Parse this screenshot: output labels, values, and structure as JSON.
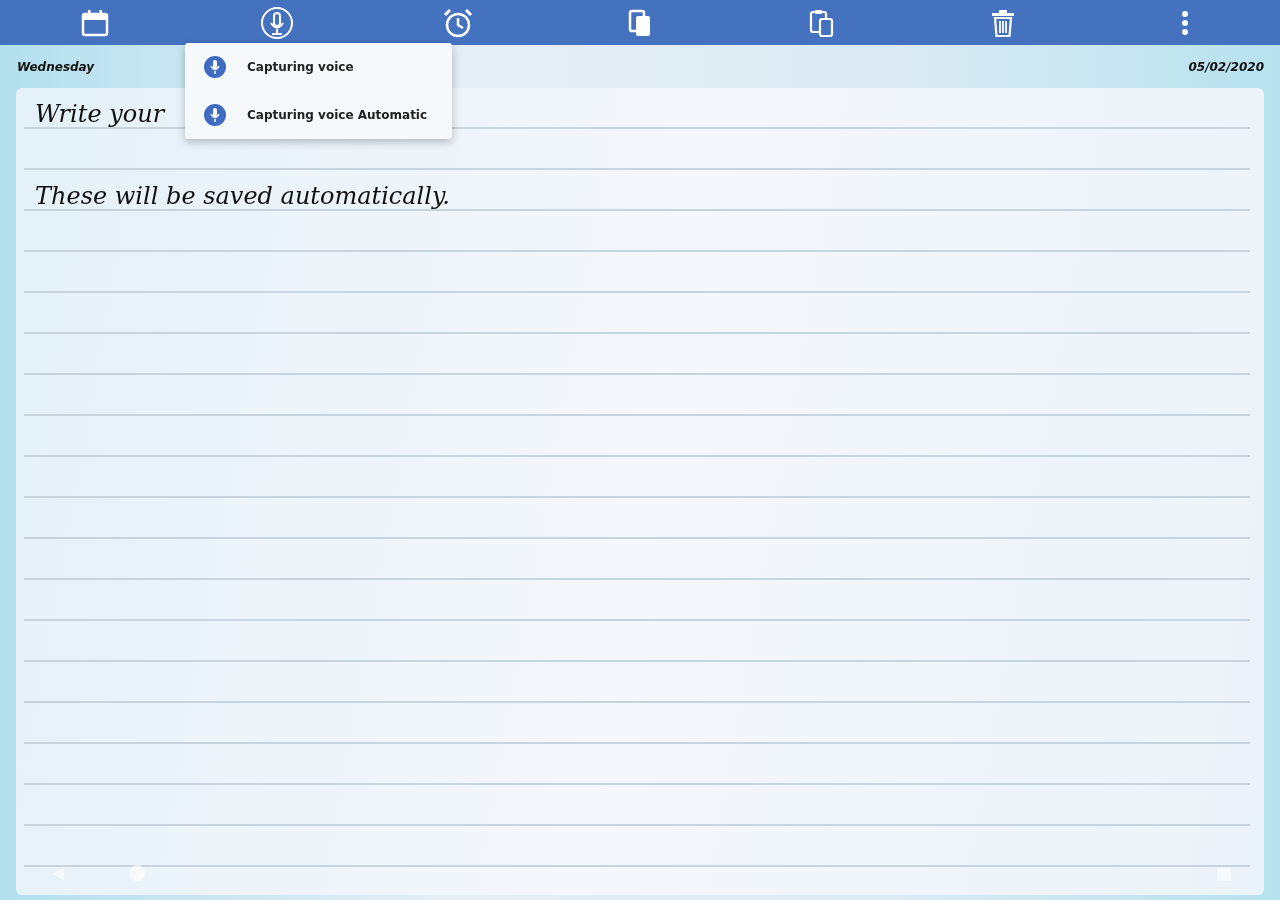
{
  "header": {
    "day": "Wednesday",
    "date": "05/02/2020"
  },
  "menu": {
    "items": [
      {
        "label": "Capturing voice"
      },
      {
        "label": "Capturing voice Automatic"
      }
    ]
  },
  "note": {
    "paragraphs": [
      "Write your",
      "These will be saved automatically."
    ]
  }
}
